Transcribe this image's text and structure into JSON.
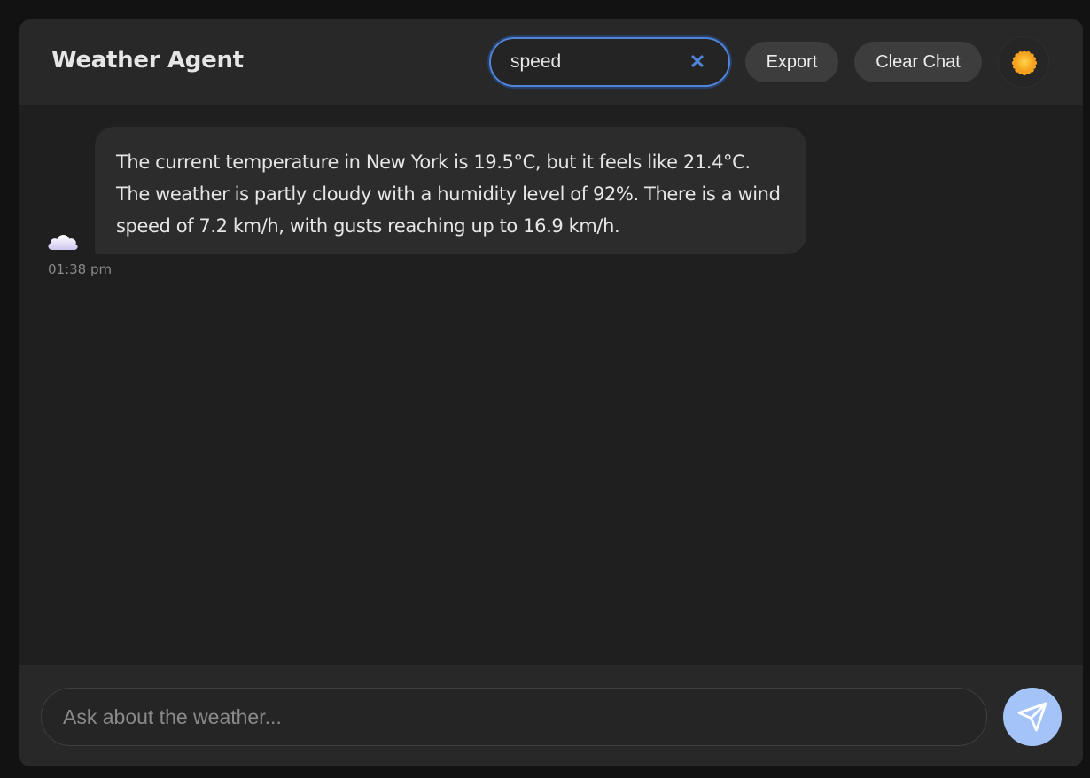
{
  "header": {
    "title": "Weather Agent",
    "search_value": "speed",
    "clear_search_icon": "close-icon",
    "export_label": "Export",
    "clear_chat_label": "Clear Chat",
    "theme_toggle_icon": "sun-icon"
  },
  "messages": [
    {
      "sender_icon": "cloud-icon",
      "text": "The current temperature in New York is 19.5°C, but it feels like 21.4°C. The weather is partly cloudy with a humidity level of 92%. There is a wind speed of 7.2 km/h, with gusts reaching up to 16.9 km/h.",
      "time": "01:38 pm"
    }
  ],
  "composer": {
    "placeholder": "Ask about the weather...",
    "value": "",
    "send_icon": "send-icon"
  },
  "colors": {
    "page_background": "#121212",
    "app_background": "#1f1f1f",
    "header_background": "#282828",
    "bubble_background": "#2c2c2c",
    "accent": "#4f84d8",
    "send_button": "#a4c4f7"
  }
}
